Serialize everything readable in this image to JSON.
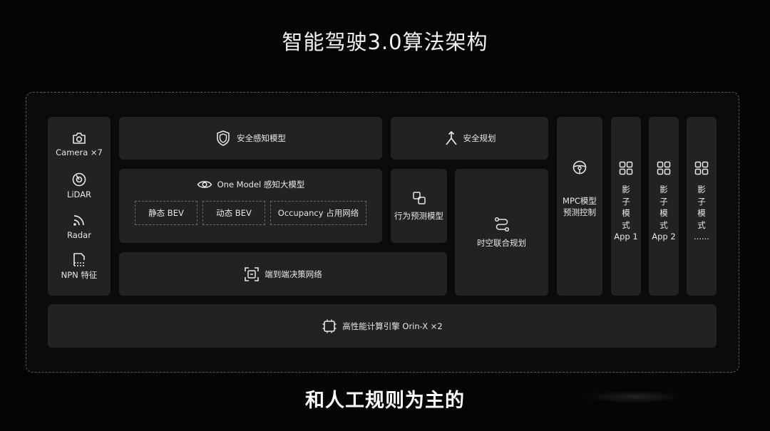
{
  "title": "智能驾驶3.0算法架构",
  "subtitle": "和人工规则为主的",
  "sensors": [
    {
      "label": "Camera ×7",
      "icon": "camera-icon"
    },
    {
      "label": "LiDAR",
      "icon": "lidar-icon"
    },
    {
      "label": "Radar",
      "icon": "radar-icon"
    },
    {
      "label": "NPN 特征",
      "icon": "document-icon"
    }
  ],
  "safety_perception": {
    "label": "安全感知模型",
    "icon": "shield-icon"
  },
  "safety_planning": {
    "label": "安全规划",
    "icon": "fork-arrow-icon"
  },
  "one_model": {
    "label": "One Model 感知大模型",
    "icon": "eye-icon",
    "items": [
      "静态 BEV",
      "动态 BEV",
      "Occupancy 占用网络"
    ]
  },
  "behavior_prediction": {
    "label": "行为预测模型",
    "icon": "squares-icon"
  },
  "spatiotemporal_planning": {
    "label": "时空联合规划",
    "icon": "route-icon"
  },
  "end_to_end": {
    "label": "端到端决策网络",
    "icon": "scan-icon"
  },
  "mpc": {
    "line1": "MPC模型",
    "line2": "预测控制",
    "icon": "steering-wheel-icon"
  },
  "shadow_modes": [
    {
      "chars": [
        "影",
        "子",
        "模",
        "式"
      ],
      "app": "App 1",
      "icon": "grid-icon"
    },
    {
      "chars": [
        "影",
        "子",
        "模",
        "式"
      ],
      "app": "App 2",
      "icon": "grid-icon"
    },
    {
      "chars": [
        "影",
        "子",
        "模",
        "式"
      ],
      "app": "......",
      "icon": "grid-icon"
    }
  ],
  "compute": {
    "label": "高性能计算引擎 Orin-X ×2",
    "icon": "chip-icon"
  }
}
